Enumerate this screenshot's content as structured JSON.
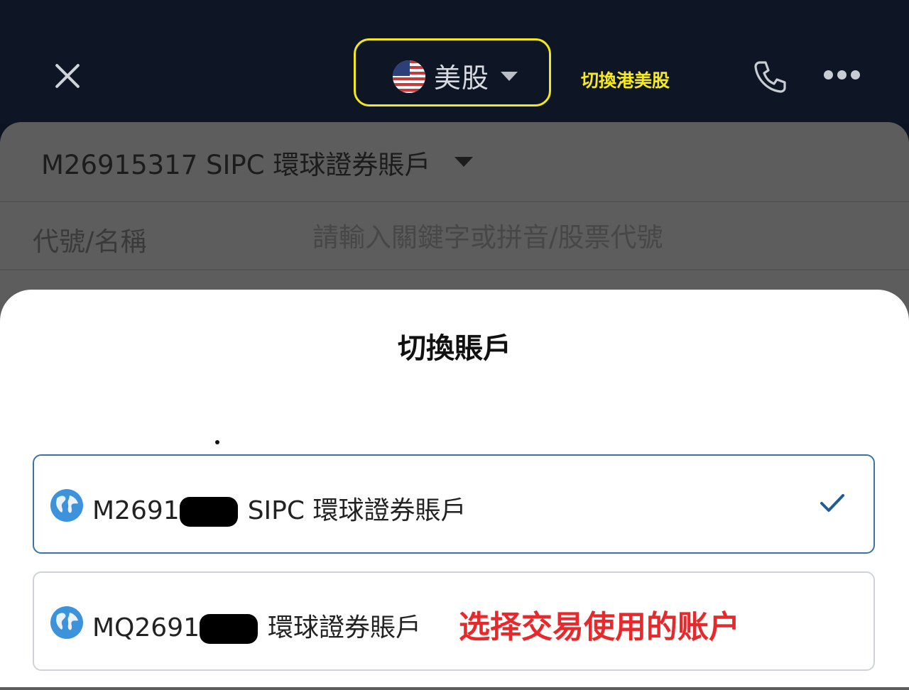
{
  "header": {
    "close_icon": "close-icon",
    "market": {
      "label": "美股",
      "flag": "us-flag-icon"
    },
    "annotation_switch": "切換港美股",
    "phone_icon": "phone-icon",
    "more_icon": "more-icon"
  },
  "order_page": {
    "account_selector": "M26915317 SIPC 環球證券賬戶",
    "code_label": "代號/名稱",
    "code_placeholder": "請輸入關鍵字或拼音/股票代號"
  },
  "modal": {
    "title": "切換賬戶",
    "accounts": [
      {
        "prefix": "M2691",
        "suffix": "SIPC 環球證券賬戶",
        "selected": true,
        "icon": "globe-icon"
      },
      {
        "prefix": "MQ2691",
        "suffix": "環球證券賬戶",
        "selected": false,
        "icon": "globe-icon"
      }
    ],
    "annotation_choose": "选择交易使用的账户"
  },
  "colors": {
    "header_bg": "#0e1524",
    "highlight_yellow": "#f2e81c",
    "selected_border": "#3b74a4",
    "check": "#1f5d95",
    "annotation_red": "#e8282b"
  }
}
